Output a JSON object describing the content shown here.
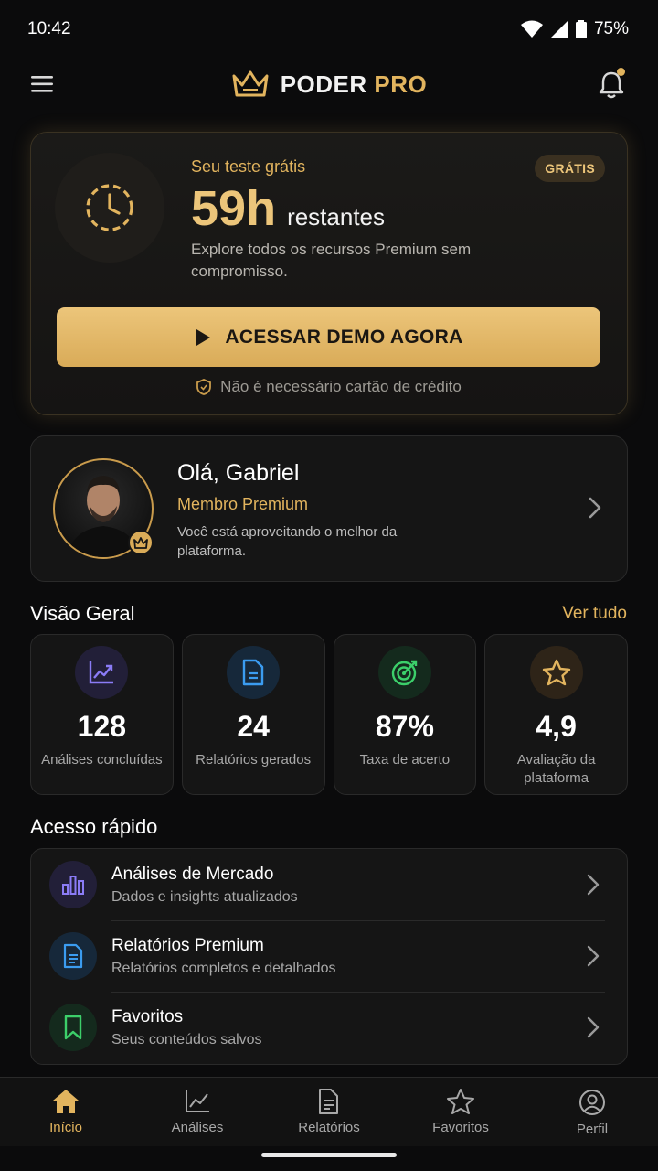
{
  "status_bar": {
    "time": "10:42",
    "battery": "75%"
  },
  "header": {
    "brand_main": "PODER",
    "brand_accent": "PRO"
  },
  "trial": {
    "eyebrow": "Seu teste grátis",
    "hours": "59h",
    "hours_suffix": "restantes",
    "description": "Explore todos os recursos Premium sem compromisso.",
    "badge": "GRÁTIS",
    "cta_label": "ACESSAR DEMO AGORA",
    "note": "Não é necessário cartão de crédito"
  },
  "profile": {
    "greeting": "Olá, Gabriel",
    "tier": "Membro Premium",
    "description": "Você está aproveitando o melhor da plataforma."
  },
  "overview": {
    "title": "Visão Geral",
    "see_all": "Ver tudo",
    "stats": [
      {
        "value": "128",
        "label": "Análises concluídas",
        "icon": "trend-chart-icon",
        "color": "#8b7cf6"
      },
      {
        "value": "24",
        "label": "Relatórios gerados",
        "icon": "document-icon",
        "color": "#3b9cf0"
      },
      {
        "value": "87%",
        "label": "Taxa de acerto",
        "icon": "target-icon",
        "color": "#3ccf6a"
      },
      {
        "value": "4,9",
        "label": "Avaliação da plataforma",
        "icon": "star-icon",
        "color": "#e2b45e"
      }
    ]
  },
  "quick_access": {
    "title": "Acesso rápido",
    "items": [
      {
        "title": "Análises de Mercado",
        "subtitle": "Dados e insights atualizados",
        "icon": "bar-chart-icon"
      },
      {
        "title": "Relatórios Premium",
        "subtitle": "Relatórios completos e detalhados",
        "icon": "document-icon"
      },
      {
        "title": "Favoritos",
        "subtitle": "Seus conteúdos salvos",
        "icon": "bookmark-icon"
      }
    ]
  },
  "bottom_nav": {
    "items": [
      {
        "label": "Início",
        "icon": "home-icon",
        "active": true
      },
      {
        "label": "Análises",
        "icon": "chart-icon",
        "active": false
      },
      {
        "label": "Relatórios",
        "icon": "document-icon",
        "active": false
      },
      {
        "label": "Favoritos",
        "icon": "star-icon",
        "active": false
      },
      {
        "label": "Perfil",
        "icon": "user-icon",
        "active": false
      }
    ]
  },
  "colors": {
    "accent": "#e2b45e",
    "background": "#0b0b0c",
    "card": "#151515"
  }
}
